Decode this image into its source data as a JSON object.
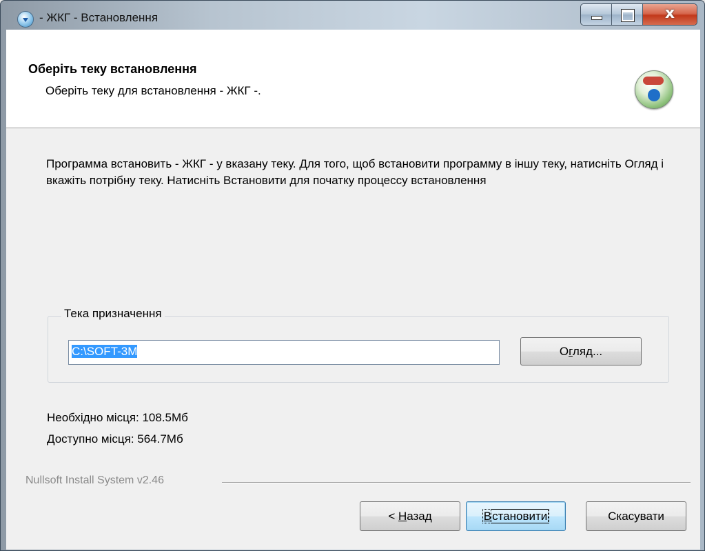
{
  "window": {
    "title": "- ЖКГ - Встановлення",
    "min_glyph": "",
    "close_glyph": "x"
  },
  "header": {
    "title": "Оберіть теку встановлення",
    "subtitle": "Оберіть теку для встановлення - ЖКГ -."
  },
  "body": {
    "description": "Программа встановить - ЖКГ - у вказану теку. Для того, щоб встановити программу в іншу теку, натисніть Огляд і вкажіть потрібну теку. Натисніть Встановити для початку процессу встановлення"
  },
  "destination": {
    "group_label": "Тека призначення",
    "path_value": "C:\\SOFT-3M",
    "browse_label_pre": "О",
    "browse_label_accel": "г",
    "browse_label_post": "ляд..."
  },
  "space": {
    "required": "Необхідно місця: 108.5Мб",
    "available": "Доступно місця: 564.7Мб"
  },
  "branding": "Nullsoft Install System v2.46",
  "buttons": {
    "back_pre": "< ",
    "back_accel": "Н",
    "back_post": "азад",
    "install_accel": "В",
    "install_post": "становити",
    "cancel": "Скасувати"
  }
}
